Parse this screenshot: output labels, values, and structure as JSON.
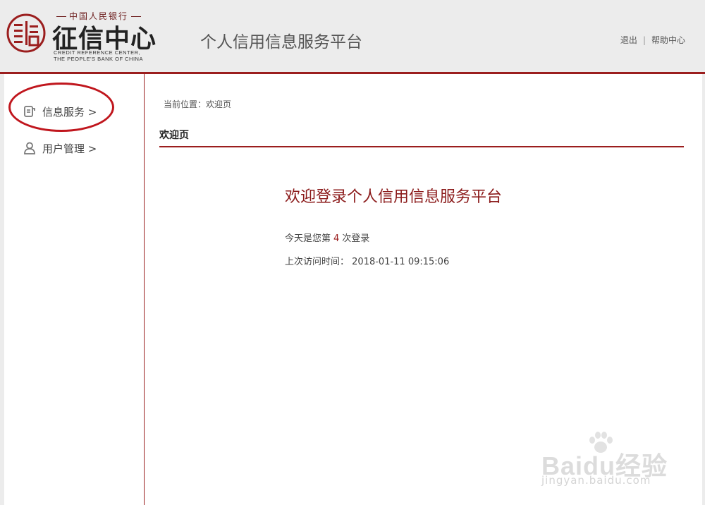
{
  "header": {
    "logo_top_text": "中国人民银行",
    "logo_main_text": "征信中心",
    "logo_en_line1": "CREDIT REFERENCE CENTER,",
    "logo_en_line2": "THE PEOPLE'S BANK OF CHINA",
    "app_title": "个人信用信息服务平台",
    "logout_label": "退出",
    "separator": "|",
    "help_label": "帮助中心"
  },
  "sidebar": {
    "items": [
      {
        "label": "信息服务 >",
        "icon": "document-icon"
      },
      {
        "label": "用户管理 >",
        "icon": "user-icon"
      }
    ]
  },
  "content": {
    "breadcrumb": "当前位置：欢迎页",
    "page_title": "欢迎页",
    "welcome_heading": "欢迎登录个人信用信息服务平台",
    "login_prefix": "今天是您第",
    "login_count": "4",
    "login_suffix": "次登录",
    "last_visit_label": "上次访问时间：",
    "last_visit_value": "2018-01-11 09:15:06"
  },
  "watermark": {
    "brand": "Baidu经验",
    "url": "jingyan.baidu.com"
  },
  "colors": {
    "accent": "#9b1e1e",
    "highlight_ring": "#c0161d",
    "header_bg": "#ececec"
  }
}
